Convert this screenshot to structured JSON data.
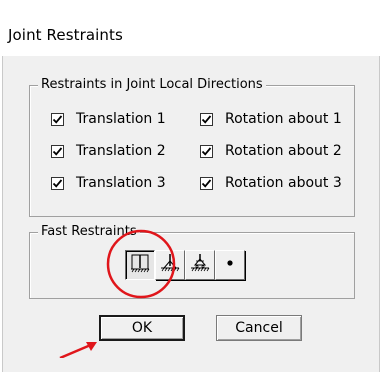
{
  "dialog": {
    "title": "Joint Restraints"
  },
  "restraints_group": {
    "label": "Restraints in Joint Local Directions",
    "checkboxes": [
      {
        "label": "Translation 1",
        "checked": true
      },
      {
        "label": "Translation 2",
        "checked": true
      },
      {
        "label": "Translation 3",
        "checked": true
      },
      {
        "label": "Rotation about 1",
        "checked": true
      },
      {
        "label": "Rotation about 2",
        "checked": true
      },
      {
        "label": "Rotation about 3",
        "checked": true
      }
    ]
  },
  "fast_group": {
    "label": "Fast Restraints",
    "buttons": [
      {
        "icon": "fixed-support-icon",
        "pressed": true
      },
      {
        "icon": "pinned-support-icon",
        "pressed": false
      },
      {
        "icon": "roller-support-icon",
        "pressed": false
      },
      {
        "icon": "free-joint-icon",
        "pressed": false
      }
    ]
  },
  "actions": {
    "ok_label": "OK",
    "cancel_label": "Cancel"
  },
  "annotations": {
    "highlight_color": "#e0161b",
    "arrow_color": "#e0161b"
  }
}
